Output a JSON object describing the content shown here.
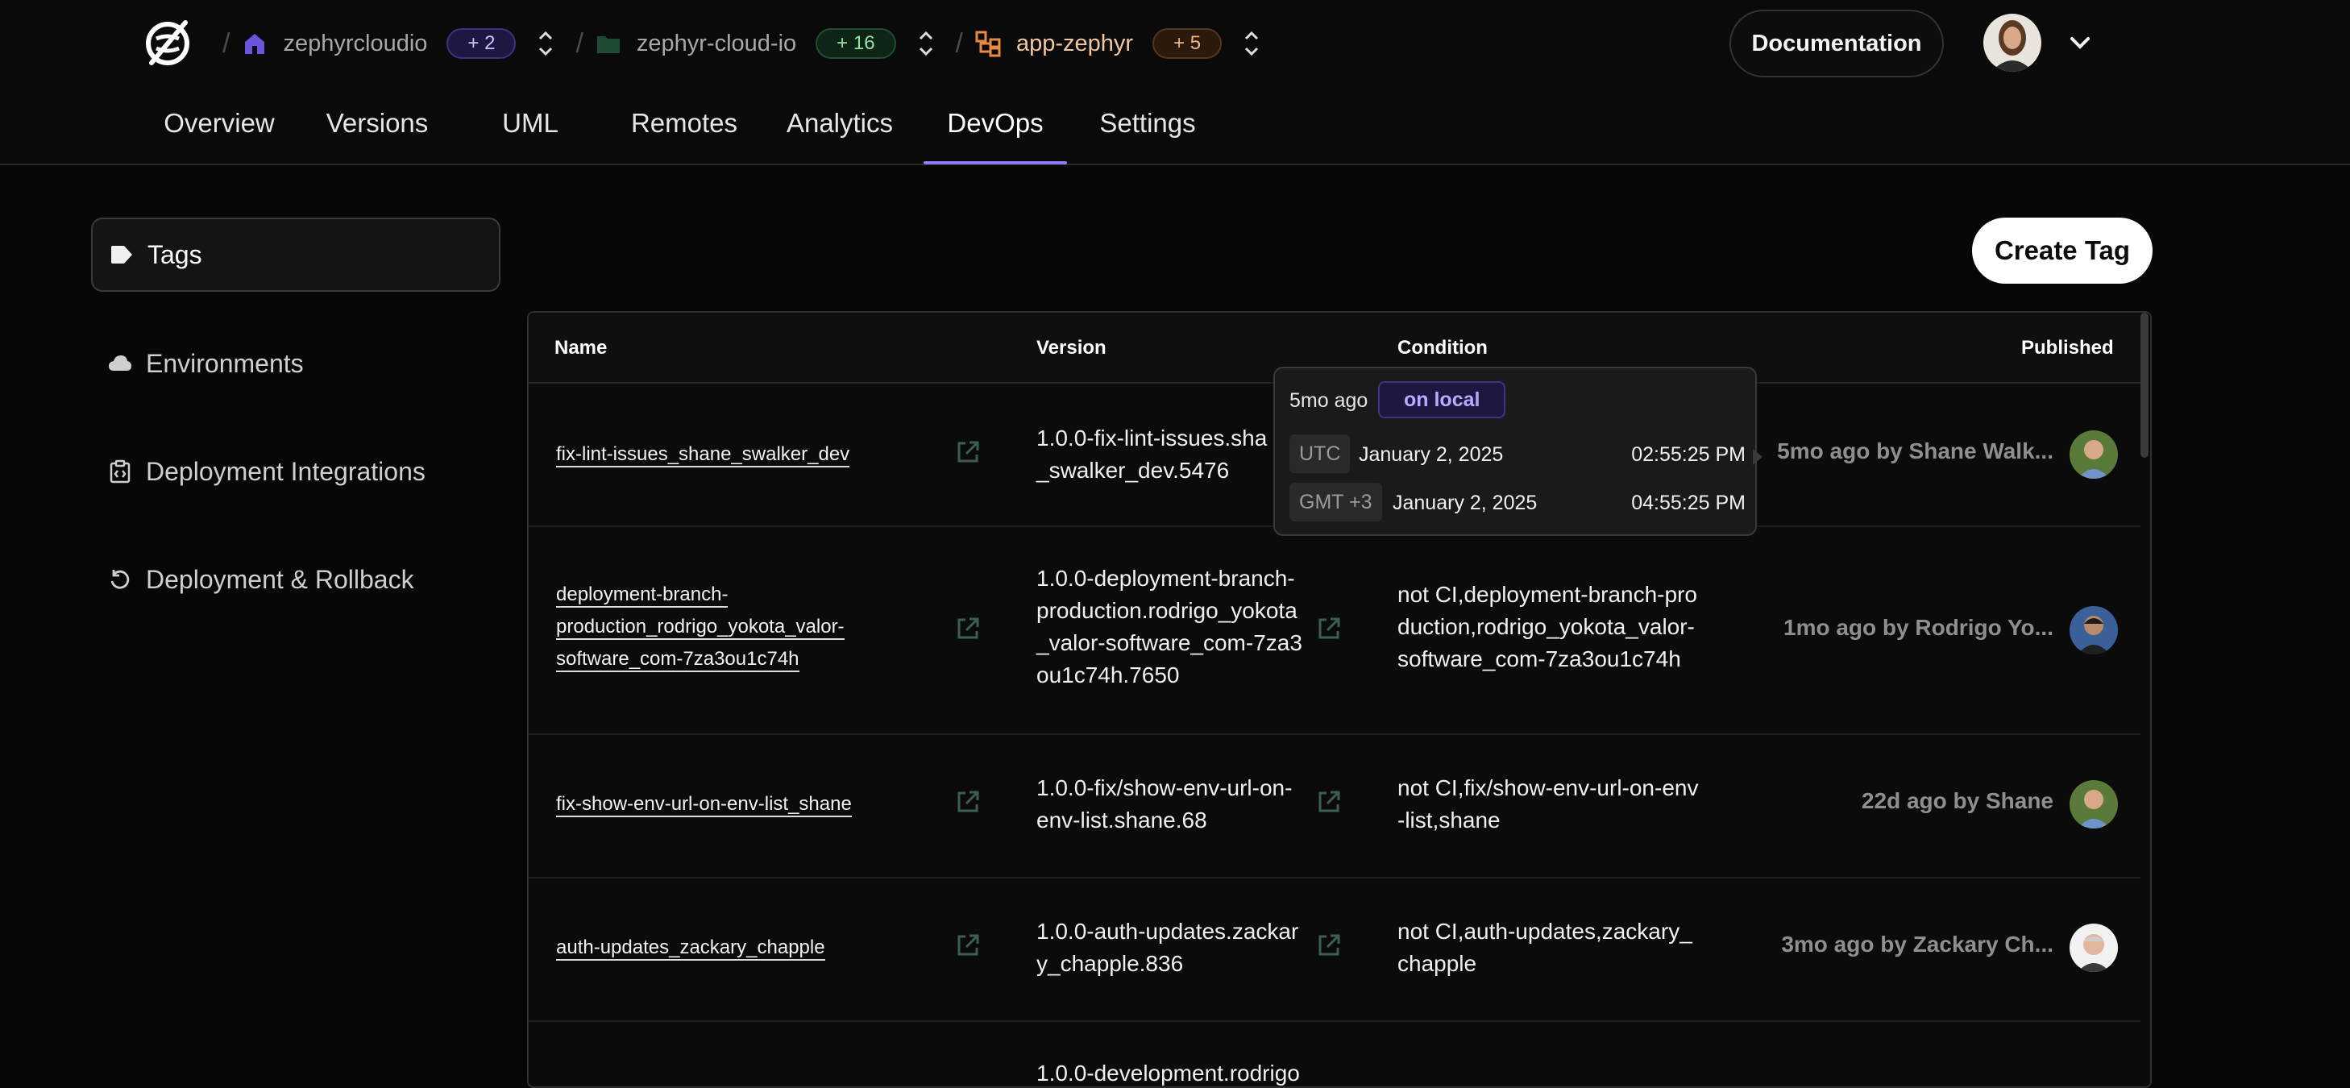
{
  "header": {
    "breadcrumbs": [
      {
        "label": "zephyrcloudio",
        "badge": "+ 2",
        "icon": "house-icon"
      },
      {
        "label": "zephyr-cloud-io",
        "badge": "+ 16",
        "icon": "folder-icon"
      },
      {
        "label": "app-zephyr",
        "badge": "+ 5",
        "icon": "app-tree-icon"
      }
    ],
    "documentation_label": "Documentation",
    "tabs": [
      {
        "label": "Overview"
      },
      {
        "label": "Versions"
      },
      {
        "label": "UML"
      },
      {
        "label": "Remotes"
      },
      {
        "label": "Analytics"
      },
      {
        "label": "DevOps",
        "active": true
      },
      {
        "label": "Settings"
      }
    ]
  },
  "sidebar": {
    "items": [
      {
        "label": "Tags",
        "icon": "tag-icon",
        "active": true
      },
      {
        "label": "Environments",
        "icon": "cloud-icon"
      },
      {
        "label": "Deployment Integrations",
        "icon": "integration-icon"
      },
      {
        "label": "Deployment & Rollback",
        "icon": "rollback-icon"
      }
    ]
  },
  "main": {
    "create_tag_label": "Create Tag",
    "columns": {
      "name": "Name",
      "version": "Version",
      "condition": "Condition",
      "published": "Published"
    },
    "rows": [
      {
        "name_lines": [
          "fix-lint-issues_shane_swalker_dev"
        ],
        "version_lines": [
          "1.0.0-fix-lint-issues.sha",
          "_swalker_dev.5476"
        ],
        "condition_lines": [],
        "published": "5mo ago by Shane Walk..."
      },
      {
        "name_lines": [
          "deployment-branch-",
          "production_rodrigo_yokota_valor-",
          "software_com-7za3ou1c74h"
        ],
        "version_lines": [
          "1.0.0-deployment-branch-",
          "production.rodrigo_yokota",
          "_valor-software_com-7za3",
          "ou1c74h.7650"
        ],
        "condition_lines": [
          "not CI,deployment-branch-pro",
          "duction,rodrigo_yokota_valor-",
          "software_com-7za3ou1c74h"
        ],
        "published": "1mo ago by Rodrigo Yo..."
      },
      {
        "name_lines": [
          "fix-show-env-url-on-env-list_shane"
        ],
        "version_lines": [
          "1.0.0-fix/show-env-url-on-",
          "env-list.shane.68"
        ],
        "condition_lines": [
          "not CI,fix/show-env-url-on-env",
          "-list,shane"
        ],
        "published": "22d ago by Shane"
      },
      {
        "name_lines": [
          "auth-updates_zackary_chapple"
        ],
        "version_lines": [
          "1.0.0-auth-updates.zackar",
          "y_chapple.836"
        ],
        "condition_lines": [
          "not CI,auth-updates,zackary_",
          "chapple"
        ],
        "published": "3mo ago by Zackary Ch..."
      },
      {
        "name_lines": [],
        "version_lines": [
          "1.0.0-development.rodrigo"
        ],
        "condition_lines": [],
        "published": ""
      }
    ],
    "tooltip": {
      "ago": "5mo ago",
      "badge": "on local",
      "rows": [
        {
          "tz": "UTC",
          "date": "January 2, 2025",
          "time": "02:55:25 PM"
        },
        {
          "tz": "GMT +3",
          "date": "January 2, 2025",
          "time": "04:55:25 PM"
        }
      ]
    }
  },
  "colors": {
    "accent": "#8b7cf5",
    "background": "#070707",
    "button_bg": "#ffffff"
  }
}
